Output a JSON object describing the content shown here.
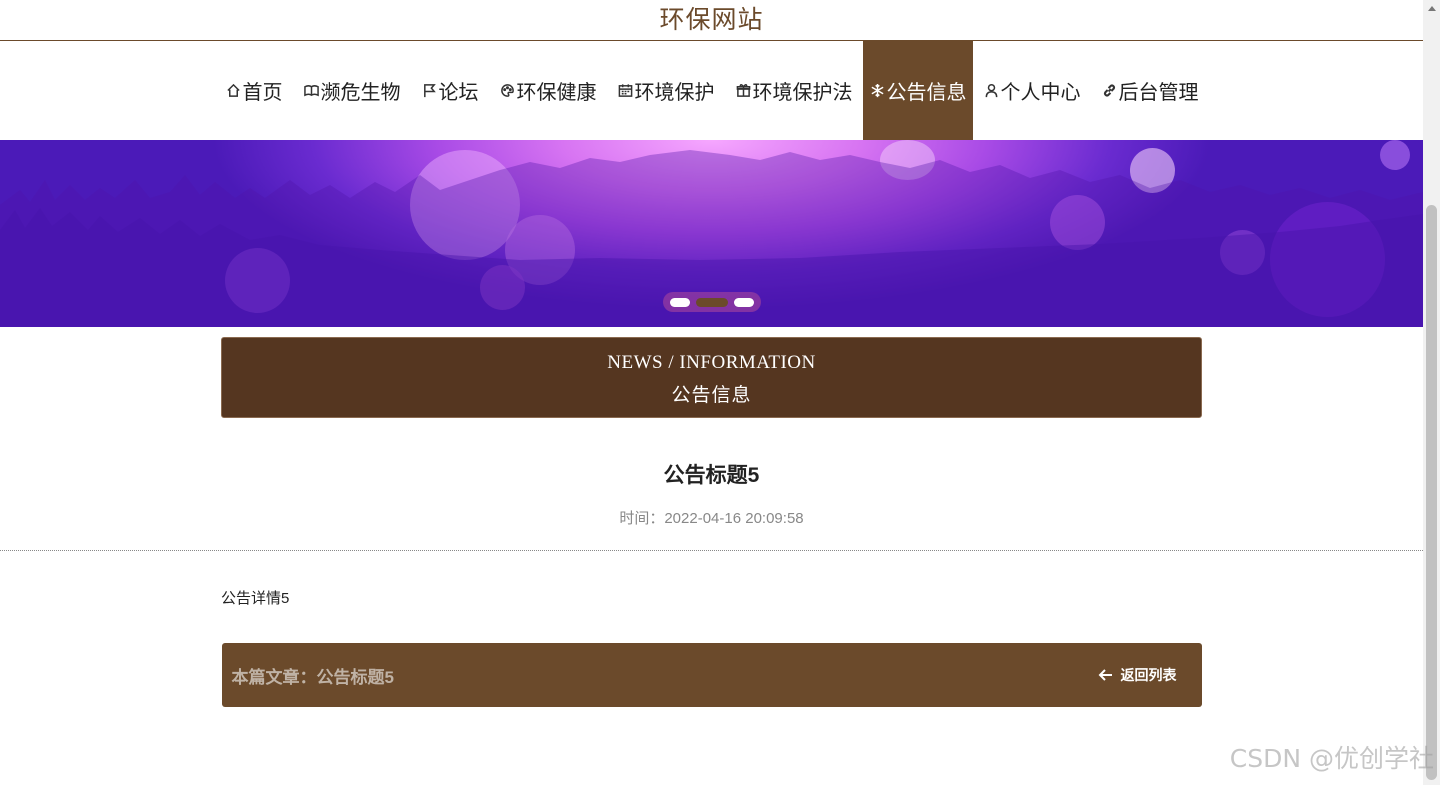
{
  "site": {
    "title": "环保网站"
  },
  "nav": {
    "items": [
      {
        "label": "首页",
        "icon": "home-icon"
      },
      {
        "label": "濒危生物",
        "icon": "book-icon"
      },
      {
        "label": "论坛",
        "icon": "flag-icon"
      },
      {
        "label": "环保健康",
        "icon": "palette-icon"
      },
      {
        "label": "环境保护",
        "icon": "calendar-icon"
      },
      {
        "label": "环境保护法",
        "icon": "gift-icon"
      },
      {
        "label": "公告信息",
        "icon": "snowflake-icon",
        "active": true
      },
      {
        "label": "个人中心",
        "icon": "user-icon"
      },
      {
        "label": "后台管理",
        "icon": "link-icon"
      }
    ]
  },
  "banner": {
    "active_slide": 2,
    "slide_count": 3
  },
  "section": {
    "en": "NEWS / INFORMATION",
    "cn": "公告信息"
  },
  "article": {
    "title": "公告标题5",
    "time": "时间：2022-04-16 20:09:58",
    "body": "公告详情5"
  },
  "footer": {
    "current": "本篇文章：公告标题5",
    "back_label": "返回列表"
  },
  "watermark": "CSDN @优创学社",
  "colors": {
    "brand": "#6b4a2b",
    "header_dark": "#553620"
  }
}
